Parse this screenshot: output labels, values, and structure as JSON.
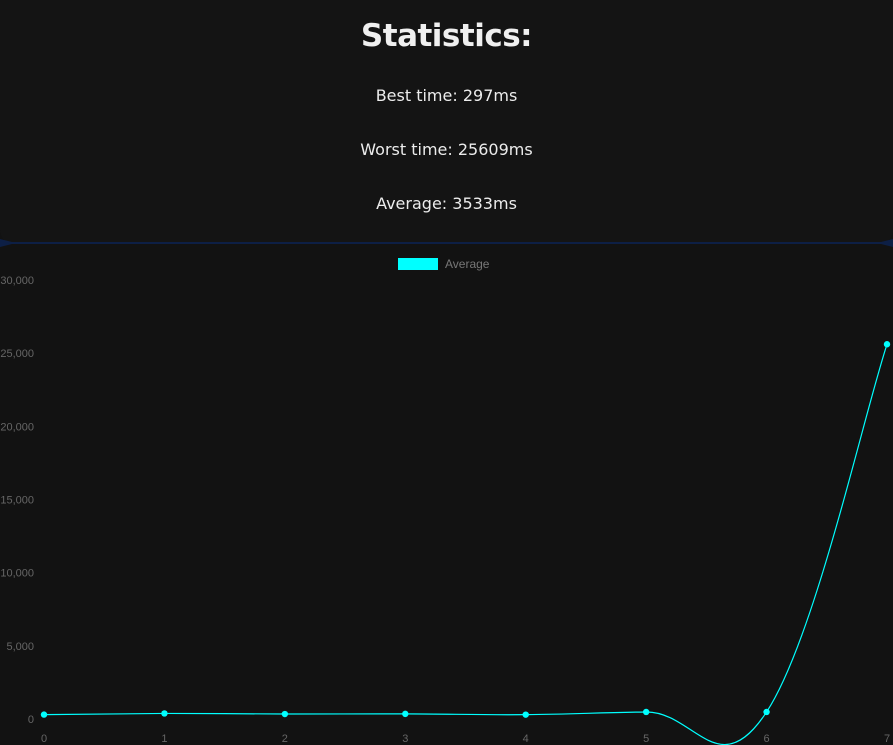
{
  "stats": {
    "title": "Statistics:",
    "best_time": "Best time: 297ms",
    "worst_time": "Worst time: 25609ms",
    "average": "Average: 3533ms"
  },
  "colors": {
    "background": "#121212",
    "panel": "#141414",
    "divider": "#0d1f45",
    "series": "#00ffff",
    "tick_text": "#666666",
    "legend_text": "#777777"
  },
  "chart_data": {
    "type": "line",
    "legend": [
      "Average"
    ],
    "legend_position": "top",
    "x": [
      0,
      1,
      2,
      3,
      4,
      5,
      6,
      7
    ],
    "series": [
      {
        "name": "Average",
        "values": [
          300,
          380,
          340,
          350,
          297,
          480,
          480,
          25609
        ]
      }
    ],
    "xlim": [
      0,
      7
    ],
    "ylim": [
      0,
      30000
    ],
    "yticks": [
      0,
      5000,
      10000,
      15000,
      20000,
      25000,
      30000
    ],
    "ytick_labels": [
      "0",
      "5,000",
      "10,000",
      "15,000",
      "20,000",
      "25,000",
      "30,000"
    ],
    "xtick_labels": [
      "0",
      "1",
      "2",
      "3",
      "4",
      "5",
      "6",
      "7"
    ],
    "grid": false,
    "title": "",
    "xlabel": "",
    "ylabel": ""
  }
}
